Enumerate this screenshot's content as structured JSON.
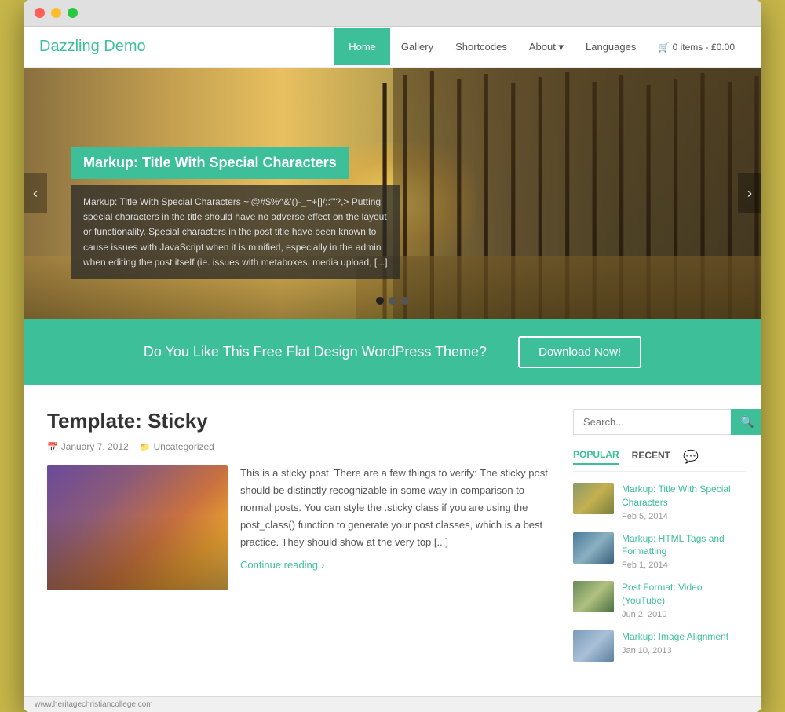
{
  "browser": {
    "url": "www.heritagechristiancollege.com"
  },
  "header": {
    "logo": "Dazzling Demo",
    "nav": [
      {
        "label": "Home",
        "active": true
      },
      {
        "label": "Gallery",
        "active": false
      },
      {
        "label": "Shortcodes",
        "active": false
      },
      {
        "label": "About ▾",
        "active": false
      },
      {
        "label": "Languages",
        "active": false
      },
      {
        "label": "🛒 0 items - £0.00",
        "active": false
      }
    ]
  },
  "hero": {
    "title": "Markup: Title With Special Characters",
    "text": "Markup: Title With Special Characters ~'@#$%^&'()-_=+[]/;:'\"?,> Putting special characters in the title should have no adverse effect on the layout or functionality. Special characters in the post title have been known to cause issues with JavaScript when it is minified, especially in the admin when editing the post itself (ie. issues with metaboxes, media upload, [...]",
    "dots": [
      {
        "active": true
      },
      {
        "active": false
      },
      {
        "active": false
      }
    ]
  },
  "cta": {
    "text": "Do You Like This Free Flat Design WordPress Theme?",
    "button": "Download Now!"
  },
  "post": {
    "title": "Template: Sticky",
    "date": "January 7, 2012",
    "category": "Uncategorized",
    "excerpt": "This is a sticky post. There are a few things to verify: The sticky post should be distinctly recognizable in some way in comparison to normal posts. You can style the .sticky class if you are using the post_class() function to generate your post classes, which is a best practice. They should show at the very top [...]",
    "continue_reading": "Continue reading"
  },
  "sidebar": {
    "search_placeholder": "Search...",
    "tabs": [
      {
        "label": "POPULAR",
        "active": true
      },
      {
        "label": "RECENT",
        "active": false
      }
    ],
    "posts": [
      {
        "title": "Markup: Title With Special Characters",
        "date": "Feb 5, 2014",
        "thumb_class": "thumb-1"
      },
      {
        "title": "Markup: HTML Tags and Formatting",
        "date": "Feb 1, 2014",
        "thumb_class": "thumb-2"
      },
      {
        "title": "Post Format: Video (YouTube)",
        "date": "Jun 2, 2010",
        "thumb_class": "thumb-3"
      },
      {
        "title": "Markup: Image Alignment",
        "date": "Jan 10, 2013",
        "thumb_class": "thumb-4"
      }
    ]
  },
  "colors": {
    "accent": "#3dbf9a"
  }
}
